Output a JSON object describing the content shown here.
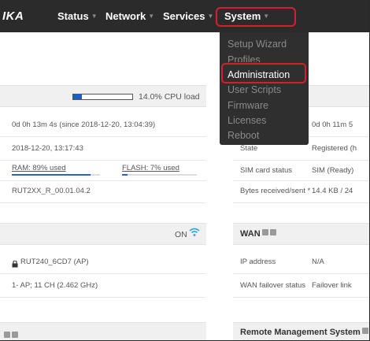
{
  "topbar": {
    "logo": "IKA",
    "nav": [
      {
        "label": "Status"
      },
      {
        "label": "Network"
      },
      {
        "label": "Services"
      },
      {
        "label": "System"
      }
    ]
  },
  "system_menu": {
    "items": [
      {
        "label": "Setup Wizard",
        "active": false
      },
      {
        "label": "Profiles",
        "active": false
      },
      {
        "label": "Administration",
        "active": true
      },
      {
        "label": "User Scripts",
        "active": false
      },
      {
        "label": "Firmware",
        "active": false
      },
      {
        "label": "Licenses",
        "active": false
      },
      {
        "label": "Reboot",
        "active": false
      }
    ]
  },
  "system_panel": {
    "cpu_load_label": "14.0% CPU load",
    "cpu_load_fraction": 0.14,
    "uptime": "0d 0h 13m 4s (since 2018-12-20, 13:04:39)",
    "local_time": "2018-12-20, 13:17:43",
    "ram_label": "RAM: 89% used",
    "ram_fraction": 0.89,
    "flash_label": "FLASH: 7% used",
    "flash_fraction": 0.07,
    "firmware": "RUT2XX_R_00.01.04.2"
  },
  "mobile_panel": {
    "uptime_partial": "0d 0h 11m 5",
    "state_label": "State",
    "state_value": "Registered (h",
    "sim_label": "SIM card status",
    "sim_value": "SIM (Ready)",
    "bytes_label": "Bytes received/sent *",
    "bytes_value": "14.4 KB / 24"
  },
  "wireless_panel": {
    "status": "ON",
    "ssid": "RUT240_6CD7 (AP)",
    "info": "1- AP; 11 CH (2.462 GHz)"
  },
  "wan_panel": {
    "title": "WAN",
    "ip_label": "IP address",
    "ip_value": "N/A",
    "failover_label": "WAN failover status",
    "failover_value": "Failover link"
  },
  "rms_panel": {
    "title": "Remote Management System"
  },
  "colors": {
    "topbar": "#2b2b2b",
    "highlight": "#d3202e",
    "bar_fill": "#1d5bd6",
    "wifi": "#3ba6e0"
  }
}
